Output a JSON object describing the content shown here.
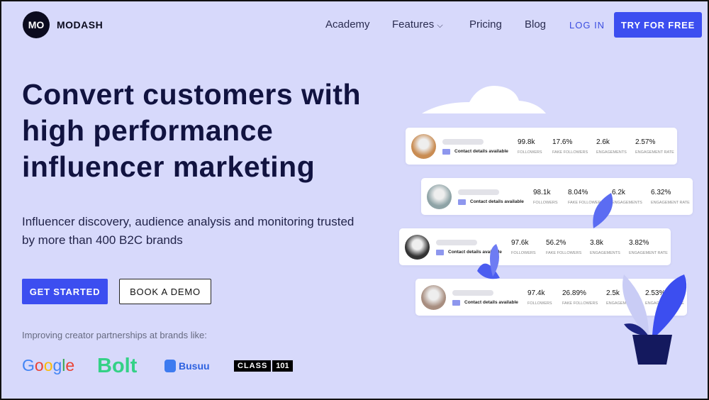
{
  "nav": {
    "logo_mark": "MO",
    "logo_text": "MODASH",
    "items": [
      "Academy",
      "Features",
      "Pricing",
      "Blog"
    ],
    "login": "LOG IN",
    "try": "TRY FOR FREE"
  },
  "hero": {
    "title": "Convert customers with high performance influencer marketing",
    "subtitle": "Influencer discovery, audience analysis and monitoring trusted by more than 400 B2C brands",
    "get_started": "GET STARTED",
    "book_demo": "BOOK A DEMO"
  },
  "brands": {
    "label": "Improving creator partnerships at brands like:",
    "items": [
      "Google",
      "Bolt",
      "Busuu",
      "CLASS",
      "101"
    ]
  },
  "stat_labels": [
    "FOLLOWERS",
    "FAKE FOLLOWERS",
    "ENGAGEMENTS",
    "ENGAGEMENT RATE"
  ],
  "contact": "Contact details available",
  "cards": [
    {
      "followers": "99.8k",
      "fake": "17.6%",
      "eng": "2.6k",
      "rate": "2.57%"
    },
    {
      "followers": "98.1k",
      "fake": "8.04%",
      "eng": "6.2k",
      "rate": "6.32%"
    },
    {
      "followers": "97.6k",
      "fake": "56.2%",
      "eng": "3.8k",
      "rate": "3.82%"
    },
    {
      "followers": "97.4k",
      "fake": "26.89%",
      "eng": "2.5k",
      "rate": "2.53%"
    }
  ],
  "colors": {
    "accent": "#3c4ef0",
    "background": "#d7d9fb"
  }
}
